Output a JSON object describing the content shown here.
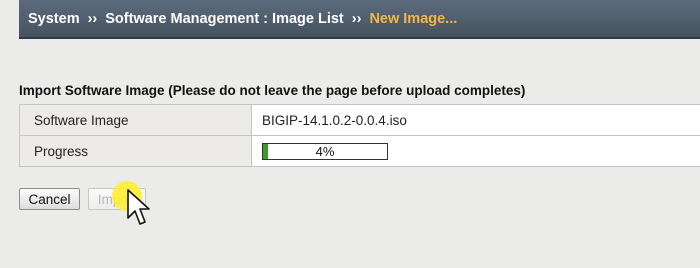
{
  "breadcrumb": {
    "items": [
      "System",
      "Software Management : Image List"
    ],
    "separator": "››",
    "current": "New Image..."
  },
  "section_title": "Import Software Image (Please do not leave the page before upload completes)",
  "properties": {
    "software_image_label": "Software Image",
    "software_image_value": "BIGIP-14.1.0.2-0.0.4.iso",
    "progress_label": "Progress",
    "progress_text": "4%",
    "progress_percent": 4
  },
  "buttons": {
    "cancel_label": "Cancel",
    "import_label": "Import"
  },
  "colors": {
    "breadcrumb_bg": "#4f5c6b",
    "breadcrumb_current": "#f5b54a",
    "progress_fill": "#3e9a2a",
    "cursor_highlight": "#ffee28"
  }
}
